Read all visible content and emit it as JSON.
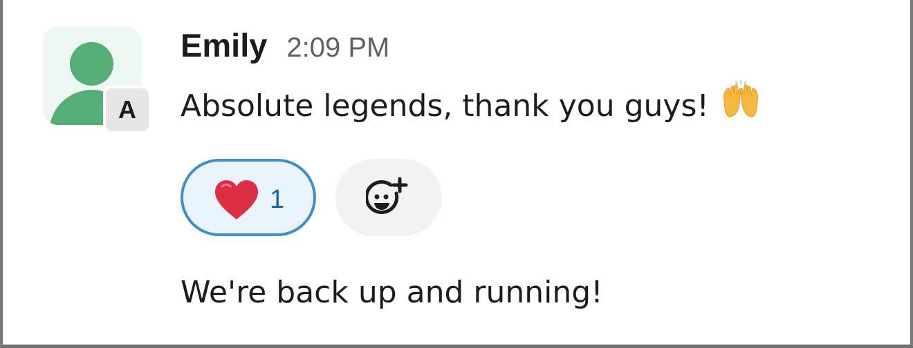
{
  "message_group": {
    "author": "Emily",
    "timestamp": "2:09 PM",
    "avatar_badge": "A",
    "messages": [
      {
        "text": "Absolute legends, thank you guys!",
        "emoji": "raising-hands"
      },
      {
        "text": "We're back up and running!"
      }
    ],
    "reactions": [
      {
        "emoji": "heart",
        "count": "1",
        "reacted_by_me": true
      }
    ],
    "add_reaction_icon": "add-emoji-icon"
  },
  "colors": {
    "avatar_bg": "#eef8f2",
    "avatar_figure": "#55ad78",
    "reaction_border": "#3f8fc9",
    "reaction_bg": "#e8f3fb",
    "reaction_count": "#1264a3",
    "timestamp": "#616061"
  }
}
